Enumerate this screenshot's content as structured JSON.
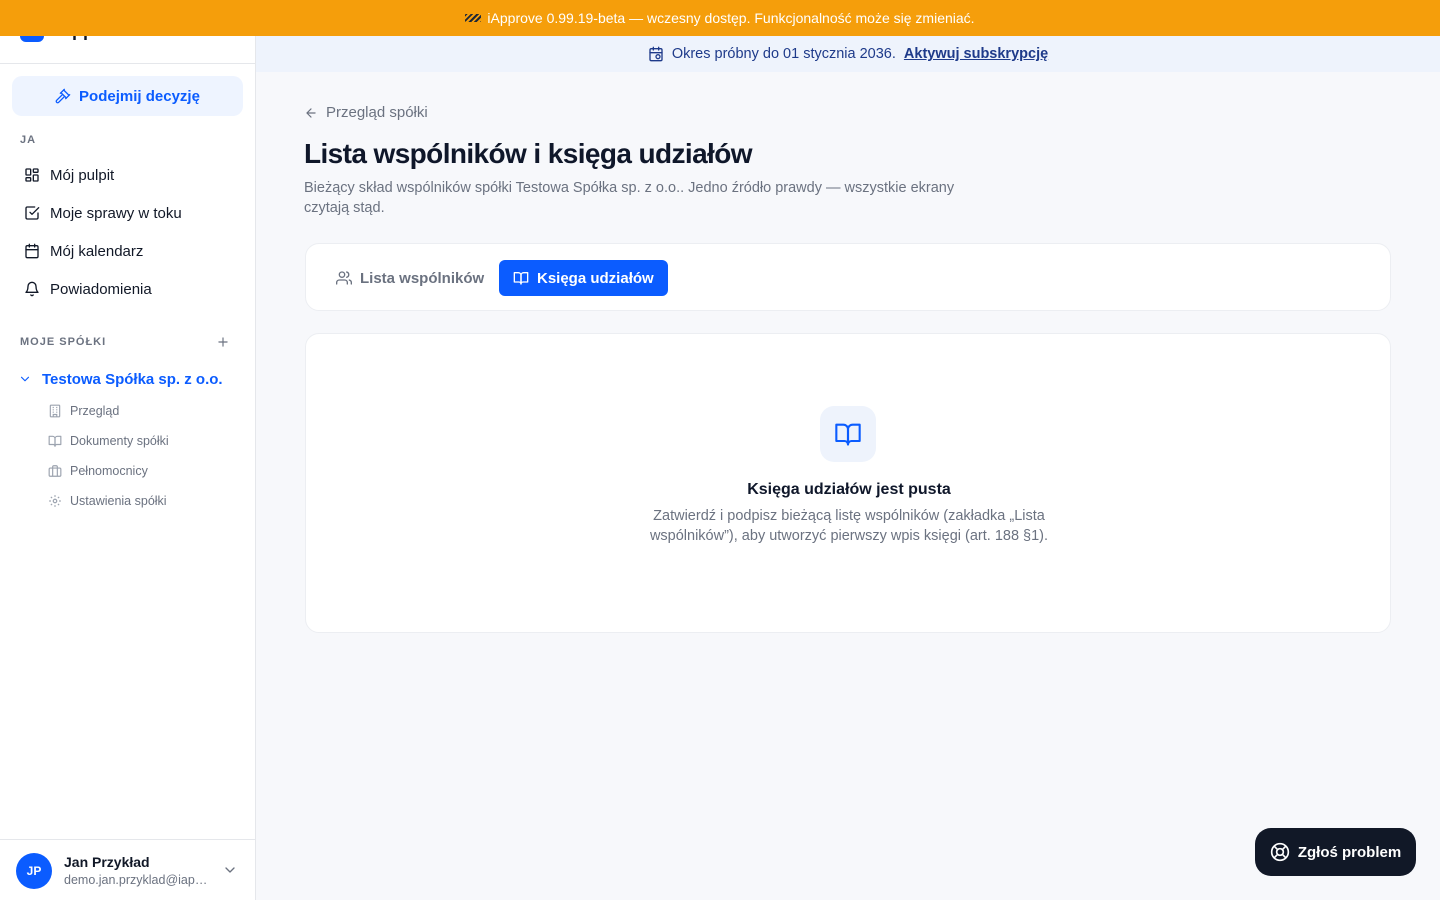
{
  "beta_banner": {
    "text": "iApprove 0.99.19-beta — wczesny dostęp. Funkcjonalność może się zmieniać."
  },
  "brand": {
    "name": "iApprove"
  },
  "sidebar": {
    "decide_button": "Podejmij decyzję",
    "section_me": "JA",
    "nav": [
      {
        "label": "Mój pulpit",
        "icon": "dashboard-icon"
      },
      {
        "label": "Moje sprawy w toku",
        "icon": "checkbox-icon"
      },
      {
        "label": "Mój kalendarz",
        "icon": "calendar-icon"
      },
      {
        "label": "Powiadomienia",
        "icon": "bell-icon"
      }
    ],
    "section_companies": "MOJE SPÓŁKI",
    "company": {
      "name": "Testowa Spółka sp. z o.o.",
      "items": [
        {
          "label": "Przegląd",
          "icon": "building-icon"
        },
        {
          "label": "Dokumenty spółki",
          "icon": "book-icon"
        },
        {
          "label": "Pełnomocnicy",
          "icon": "briefcase-icon"
        },
        {
          "label": "Ustawienia spółki",
          "icon": "gear-icon"
        }
      ]
    }
  },
  "user": {
    "initials": "JP",
    "name": "Jan Przykład",
    "email": "demo.jan.przyklad@iapprove.pl"
  },
  "trial_banner": {
    "text": "Okres próbny do 01 stycznia 2036.",
    "link": "Aktywuj subskrypcję"
  },
  "breadcrumb": {
    "back": "Przegląd spółki"
  },
  "page": {
    "title": "Lista wspólników i księga udziałów",
    "description": "Bieżący skład wspólników spółki Testowa Spółka sp. z o.o.. Jedno źródło prawdy — wszystkie ekrany czytają stąd."
  },
  "tabs": [
    {
      "label": "Lista wspólników",
      "active": false
    },
    {
      "label": "Księga udziałów",
      "active": true
    }
  ],
  "empty_state": {
    "title": "Księga udziałów jest pusta",
    "description": "Zatwierdź i podpisz bieżącą listę wspólników (zakładka „Lista wspólników”), aby utworzyć pierwszy wpis księgi (art. 188 §1)."
  },
  "report_button": "Zgłoś problem",
  "colors": {
    "accent": "#0b5cff",
    "beta_banner": "#f59e0b",
    "trial_banner": "#eef3fc",
    "report_button": "#111827"
  }
}
